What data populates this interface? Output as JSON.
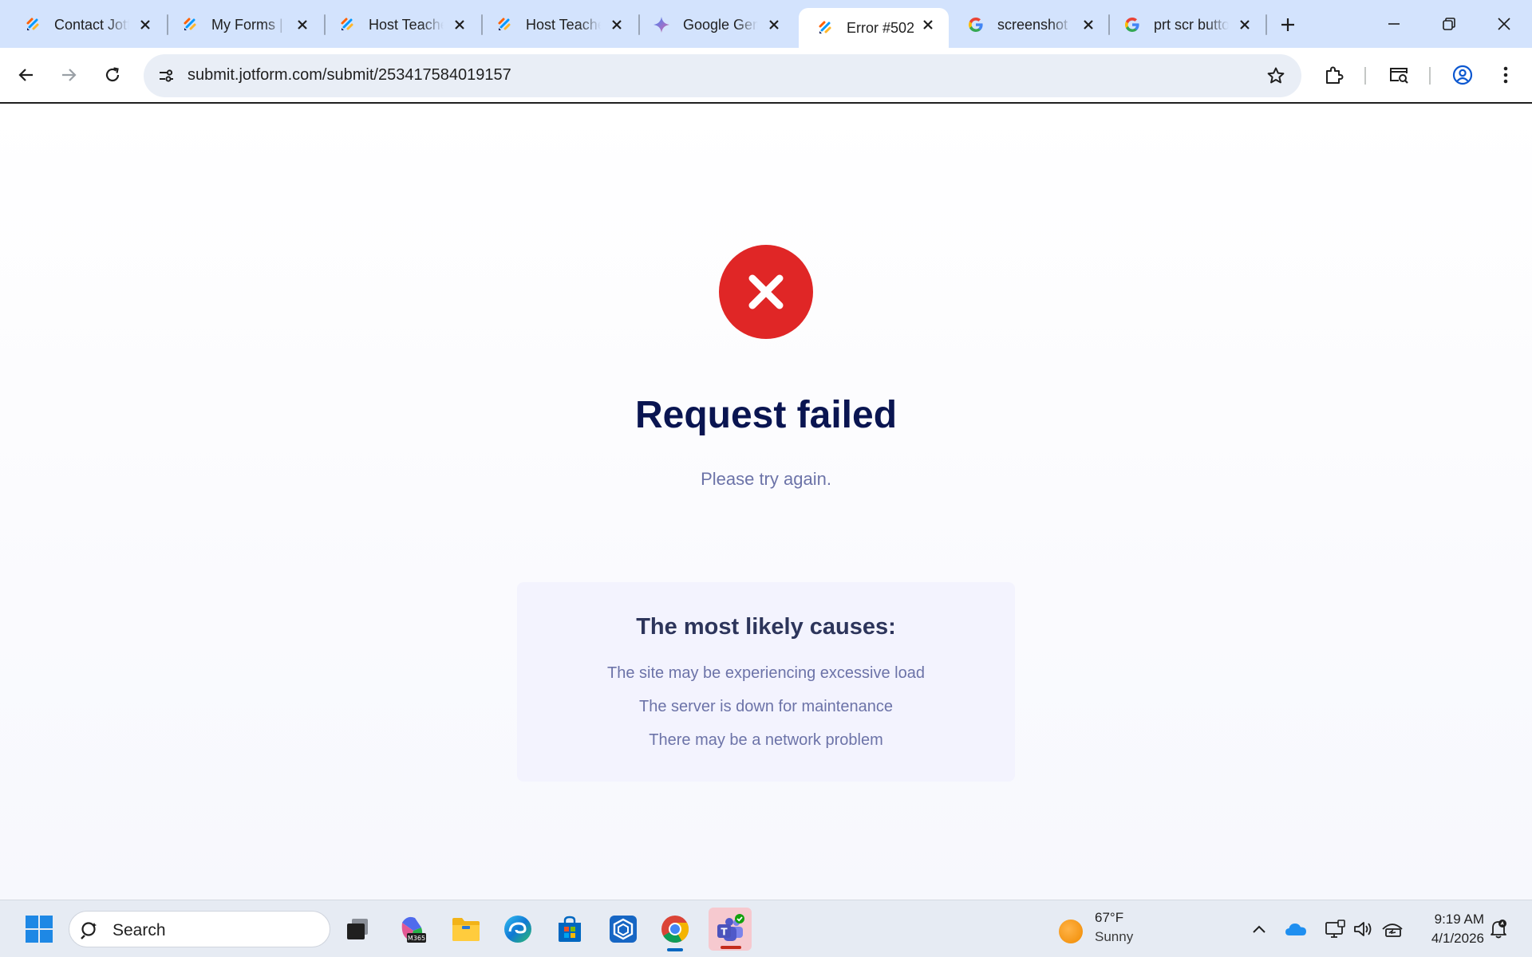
{
  "browser": {
    "tabs": [
      {
        "title": "Contact Jotform",
        "icon": "jotform-icon"
      },
      {
        "title": "My Forms | Jotform",
        "icon": "jotform-icon"
      },
      {
        "title": "Host Teacher",
        "icon": "jotform-icon"
      },
      {
        "title": "Host Teacher",
        "icon": "jotform-icon"
      },
      {
        "title": "Google Gemini",
        "icon": "gemini-icon"
      },
      {
        "title": "Error #502",
        "icon": "jotform-icon",
        "active": true
      },
      {
        "title": "screenshot",
        "icon": "google-icon"
      },
      {
        "title": "prt scr button",
        "icon": "google-icon"
      }
    ],
    "url": "submit.jotform.com/submit/253417584019157"
  },
  "page": {
    "icon": "error-x-icon",
    "heading": "Request failed",
    "subtext": "Please try again.",
    "causes": {
      "title": "The most likely causes:",
      "items": [
        "The site may be experiencing excessive load",
        "The server is down for maintenance",
        "There may be a network problem"
      ]
    }
  },
  "taskbar": {
    "search_label": "Search",
    "apps": [
      "start-icon",
      "task-view-icon",
      "microsoft-365-icon",
      "file-explorer-icon",
      "edge-icon",
      "store-icon",
      "company-portal-icon",
      "chrome-icon",
      "teams-icon"
    ],
    "weather": {
      "temp": "67°F",
      "condition": "Sunny"
    },
    "clock": {
      "time": "9:19 AM",
      "date": "4/1/2026"
    }
  },
  "colors": {
    "error_red": "#e02626",
    "heading_navy": "#0a1551",
    "muted_text": "#6c73a8",
    "tabstrip_bg": "#d3e3fd"
  }
}
